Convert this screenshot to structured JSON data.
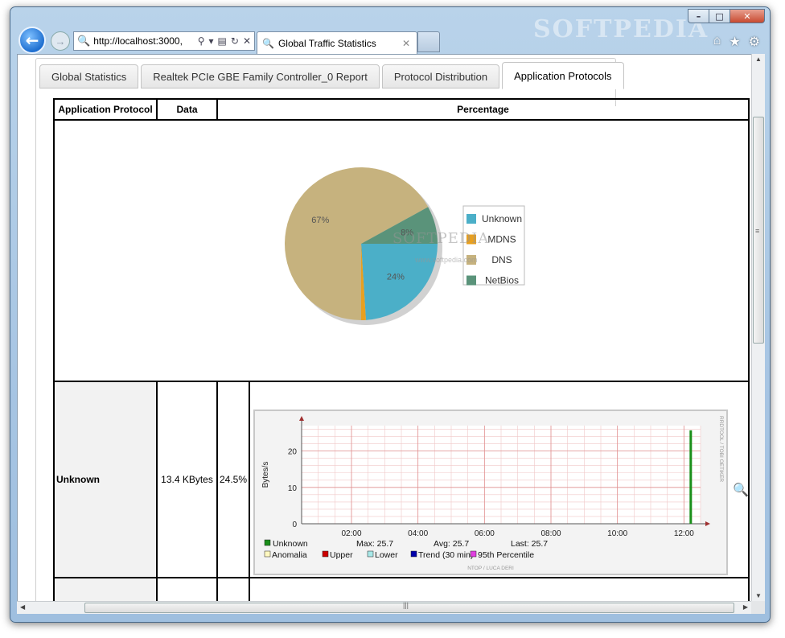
{
  "browser": {
    "address": "http://localhost:3000,",
    "tab_title": "Global Traffic Statistics",
    "watermark": "SOFTPEDIA"
  },
  "tabs": [
    {
      "label": "Global Statistics"
    },
    {
      "label": "Realtek PCIe GBE Family Controller_0 Report"
    },
    {
      "label": "Protocol Distribution"
    },
    {
      "label": "Application Protocols"
    }
  ],
  "table": {
    "headers": [
      "Application Protocol",
      "Data",
      "Percentage"
    ],
    "row": {
      "protocol": "Unknown",
      "data": "13.4 KBytes",
      "percent": "24.5%"
    }
  },
  "chart_data": [
    {
      "type": "pie",
      "slices": [
        {
          "name": "Unknown",
          "value": 24,
          "color": "#4bafc8"
        },
        {
          "name": "MDNS",
          "value": 1,
          "color": "#e8a020"
        },
        {
          "name": "DNS",
          "value": 67,
          "color": "#c6b27e"
        },
        {
          "name": "NetBios",
          "value": 8,
          "color": "#5a937a"
        }
      ],
      "labels": [
        "67%",
        "8%",
        "24%"
      ],
      "legend": "right"
    },
    {
      "type": "bar",
      "ylabel": "Bytes/s",
      "ylim": [
        0,
        27
      ],
      "yticks": [
        "0",
        "10",
        "20"
      ],
      "xticks": [
        "02:00",
        "04:00",
        "06:00",
        "08:00",
        "10:00",
        "12:00"
      ],
      "series": [
        {
          "name": "Unknown",
          "color": "#1a8f1a",
          "x": "12:20",
          "value": 25.7
        }
      ],
      "stats": {
        "max": "Max: 25.7",
        "avg": "Avg: 25.7",
        "last": "Last: 25.7"
      },
      "legend": [
        {
          "name": "Unknown",
          "color": "#1a8f1a"
        },
        {
          "name": "Anomalia",
          "color": "#fff8c0"
        },
        {
          "name": "Upper",
          "color": "#cc0000"
        },
        {
          "name": "Lower",
          "color": "#a8e8e8"
        },
        {
          "name": "Trend (30 min)",
          "color": "#0000aa"
        },
        {
          "name": "95th Percentile",
          "color": "#e040e0"
        }
      ],
      "side_label": "RRDTOOL / TOBI OETIKER",
      "footer": "NTOP / LUCA DERI"
    }
  ]
}
